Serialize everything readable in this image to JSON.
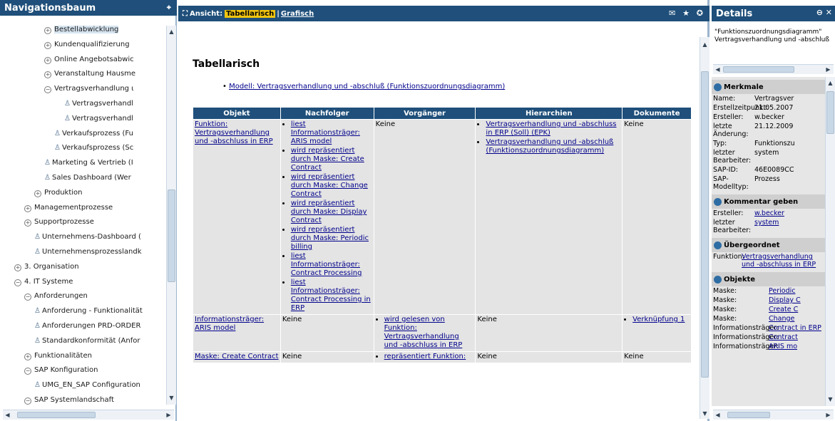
{
  "nav": {
    "title": "Navigationsbaum",
    "pin": "⌖",
    "items": [
      {
        "label": "Bestellabwicklung",
        "kind": "plus",
        "indent": 4,
        "selected": true
      },
      {
        "label": "Kundenqualifizierung",
        "kind": "plus",
        "indent": 4
      },
      {
        "label": "Online Angebotsabwic",
        "kind": "plus",
        "indent": 4
      },
      {
        "label": "Veranstaltung Hausme",
        "kind": "plus",
        "indent": 4
      },
      {
        "label": "Vertragsverhandlung ι",
        "kind": "minus",
        "indent": 4
      },
      {
        "label": "Vertragsverhandl",
        "kind": "model",
        "indent": 6
      },
      {
        "label": "Vertragsverhandl",
        "kind": "model",
        "indent": 6
      },
      {
        "label": "Verkaufsprozess (Fu",
        "kind": "model",
        "indent": 5
      },
      {
        "label": "Verkaufsprozess (Sc",
        "kind": "model",
        "indent": 5
      },
      {
        "label": "Marketing & Vertrieb (I",
        "kind": "model",
        "indent": 4
      },
      {
        "label": "Sales Dashboard (Wer",
        "kind": "model",
        "indent": 4
      },
      {
        "label": "Produktion",
        "kind": "plus",
        "indent": 3
      },
      {
        "label": "Managementprozesse",
        "kind": "plus",
        "indent": 2
      },
      {
        "label": "Supportprozesse",
        "kind": "plus",
        "indent": 2
      },
      {
        "label": "Unternehmens-Dashboard (",
        "kind": "model",
        "indent": 3
      },
      {
        "label": "Unternehmensprozesslandk",
        "kind": "model",
        "indent": 3
      },
      {
        "label": "3. Organisation",
        "kind": "plus",
        "indent": 1
      },
      {
        "label": "4. IT Systeme",
        "kind": "minus",
        "indent": 1
      },
      {
        "label": "Anforderungen",
        "kind": "minus",
        "indent": 2
      },
      {
        "label": "Anforderung - Funktionalität",
        "kind": "model",
        "indent": 3
      },
      {
        "label": "Anforderungen PRD-ORDER",
        "kind": "model",
        "indent": 3
      },
      {
        "label": "Standardkonformität (Anfor",
        "kind": "model",
        "indent": 3
      },
      {
        "label": "Funktionalitäten",
        "kind": "plus",
        "indent": 2
      },
      {
        "label": "SAP Konfiguration",
        "kind": "minus",
        "indent": 2
      },
      {
        "label": "UMG_EN_SAP Configuration",
        "kind": "model",
        "indent": 3
      },
      {
        "label": "SAP Systemlandschaft",
        "kind": "minus",
        "indent": 2
      }
    ]
  },
  "view": {
    "prefix": "Ansicht:",
    "current": "Tabellarisch",
    "alt": "Grafisch",
    "tools": "✉ ★ ✪"
  },
  "content": {
    "heading": "Tabellarisch",
    "model_link": "Modell: Vertragsverhandlung und -abschluß (Funktionszuordnungsdiagramm)",
    "headers": [
      "Objekt",
      "Nachfolger",
      "Vorgänger",
      "Hierarchien",
      "Dokumente"
    ],
    "rows": [
      {
        "objekt": "Funktion: Vertragsverhandlung und -abschluss in ERP",
        "nachfolger": [
          "liest Informationsträger: ARIS model",
          "wird repräsentiert durch Maske: Create Contract",
          "wird repräsentiert durch Maske: Change Contract",
          "wird repräsentiert durch Maske: Display Contract",
          "wird repräsentiert durch Maske: Periodic billing",
          "liest Informationsträger: Contract Processing",
          "liest Informationsträger: Contract Processing in ERP"
        ],
        "vorgaenger": "Keine",
        "hierarchien": [
          "Vertragsverhandlung und -abschluss in ERP (Soll) (EPK)",
          "Vertragsverhandlung und -abschluß (Funktionszuordnungsdiagramm)"
        ],
        "dokumente": "Keine"
      },
      {
        "objekt": "Informationsträger: ARIS model",
        "nachfolger_text": "Keine",
        "vorgaenger_list": [
          "wird gelesen von Funktion: Vertragsverhandlung und -abschluss in ERP"
        ],
        "hierarchien_text": "Keine",
        "dokumente_list": [
          "Verknüpfung 1"
        ]
      },
      {
        "objekt": "Maske: Create Contract",
        "nachfolger_text": "Keine",
        "vorgaenger_list": [
          "repräsentiert Funktion:"
        ],
        "hierarchien_text": "Keine",
        "dokumente_text": "Keine"
      }
    ]
  },
  "details": {
    "title": "Details",
    "tools": "⊖ ✕",
    "object_title": "\"Funktionszuordnungsdiagramm\" Vertragsverhandlung und -abschluß",
    "merkmale_label": "Merkmale",
    "merkmale": [
      {
        "k": "Name:",
        "v": "Vertragsver"
      },
      {
        "k": "Erstellzeitpunkt:",
        "v": "21.05.2007"
      },
      {
        "k": "Ersteller:",
        "v": "w.becker"
      },
      {
        "k": "letzte Änderung:",
        "v": "21.12.2009"
      },
      {
        "k": "Typ:",
        "v": "Funktionszu"
      },
      {
        "k": "letzter Bearbeiter:",
        "v": "system"
      },
      {
        "k": "SAP-ID:",
        "v": "46E0089CC"
      },
      {
        "k": "SAP-Modelltyp:",
        "v": "Prozess"
      }
    ],
    "kommentar_label": "Kommentar geben",
    "kommentar": [
      {
        "k": "Ersteller:",
        "v": "w.becker"
      },
      {
        "k": "letzter Bearbeiter:",
        "v": "system"
      }
    ],
    "uebergeordnet_label": "Übergeordnet",
    "uebergeordnet": {
      "k": "Funktion:",
      "v": "Vertragsverhandlung und -abschluss in ERP"
    },
    "objekte_label": "Objekte",
    "objekte": [
      {
        "k": "Maske:",
        "v": "Periodic"
      },
      {
        "k": "Maske:",
        "v": "Display C"
      },
      {
        "k": "Maske:",
        "v": "Create C"
      },
      {
        "k": "Maske:",
        "v": "Change"
      },
      {
        "k": "Informationsträger:",
        "v": "Contract in ERP"
      },
      {
        "k": "Informationsträger:",
        "v": "Contract"
      },
      {
        "k": "Informationsträger:",
        "v": "ARIS mo"
      }
    ]
  },
  "colors": {
    "header": "#1f4f7a",
    "accent": "#f1c40f",
    "link": "#00008b",
    "cell": "#e4e4e4"
  },
  "icons": {
    "plus": "tree-expand-icon",
    "minus": "tree-collapse-icon",
    "model": "model-icon"
  }
}
